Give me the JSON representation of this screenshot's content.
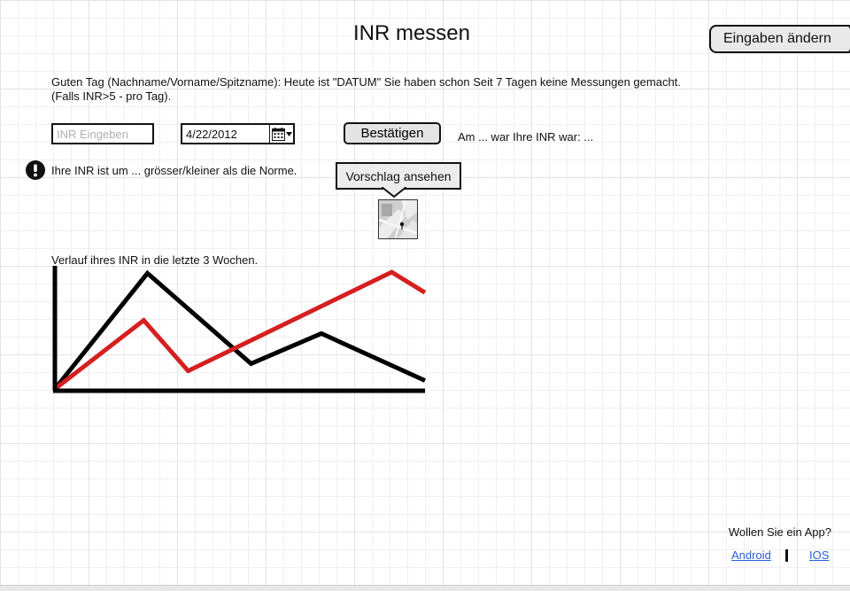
{
  "page": {
    "title": "INR messen",
    "edit_button_label": "Eingaben ändern"
  },
  "greeting": "Guten Tag (Nachname/Vorname/Spitzname): Heute ist \"DATUM\" Sie haben schon Seit 7 Tagen keine Messungen gemacht.(Falls INR>5 - pro Tag).",
  "form": {
    "inr_placeholder": "INR Eingeben",
    "date_value": "4/22/2012",
    "confirm_label": "Bestätigen",
    "last_inr_text": "Am ... war Ihre INR war: ..."
  },
  "alert": {
    "icon": "exclamation-circle-icon",
    "text": "Ihre INR ist um ... grösser/kleiner als die Norme."
  },
  "suggestion": {
    "button_label": "Vorschlag ansehen",
    "thumbnail_icon": "map-icon"
  },
  "chart_label": "Verlauf ihres INR in die letzte 3 Wochen.",
  "chart_data": {
    "type": "line",
    "title": "",
    "xlabel": "",
    "ylabel": "",
    "xlim": [
      0,
      10
    ],
    "ylim": [
      0,
      10
    ],
    "grid": false,
    "legend": "none",
    "series": [
      {
        "color": "#000000",
        "x": [
          0,
          2.5,
          5.3,
          7.2,
          10
        ],
        "y": [
          0,
          9.6,
          2.1,
          4.6,
          0.7
        ]
      },
      {
        "color": "#d42020",
        "x": [
          0,
          2.4,
          3.6,
          9.1,
          10
        ],
        "y": [
          0,
          5.7,
          1.5,
          9.7,
          8
        ]
      }
    ]
  },
  "footer": {
    "app_question": "Wollen Sie ein App?",
    "android_label": "Android",
    "ios_label": "IOS"
  },
  "colors": {
    "link": "#2b5fd9",
    "button_bg": "#e4e4e4",
    "chart_red": "#d42020"
  }
}
